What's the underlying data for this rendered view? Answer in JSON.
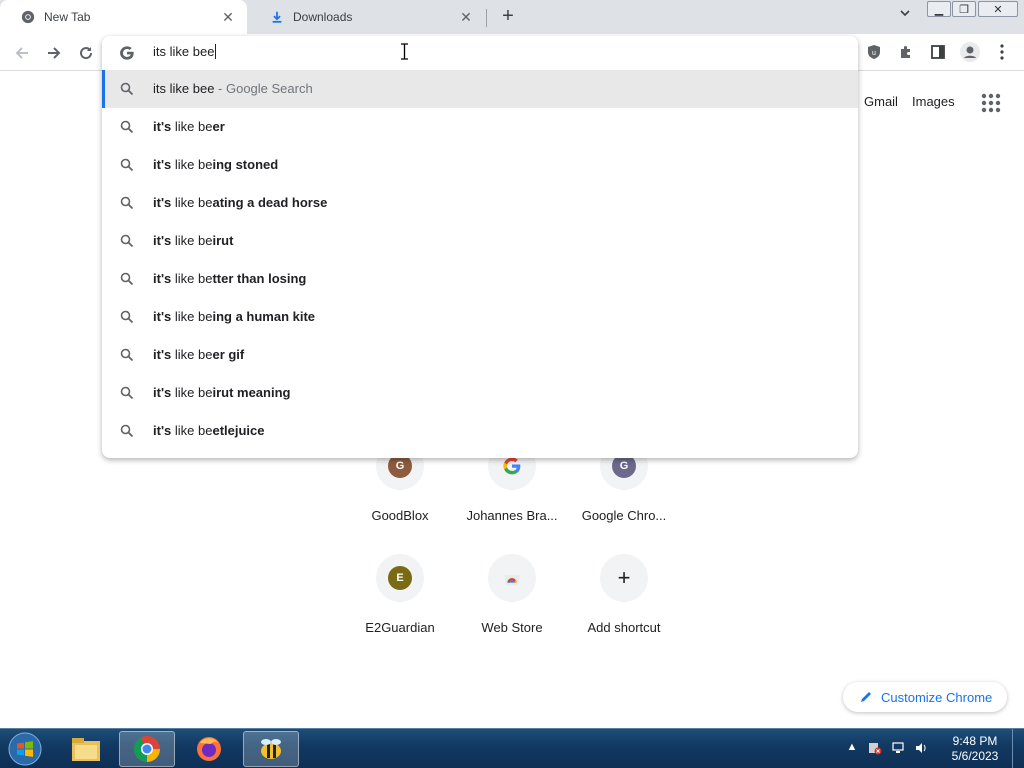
{
  "tabs": [
    {
      "title": "New Tab",
      "icon": "chrome-icon"
    },
    {
      "title": "Downloads",
      "icon": "download-icon"
    }
  ],
  "omnibox": {
    "input_value": "its like bee",
    "selected": {
      "query": "its like bee",
      "suffix": " - Google Search"
    },
    "suggestions": [
      {
        "prefix": "it's",
        "mid": " like be",
        "completion": "er"
      },
      {
        "prefix": "it's",
        "mid": " like be",
        "completion": "ing stoned"
      },
      {
        "prefix": "it's",
        "mid": " like be",
        "completion": "ating a dead horse"
      },
      {
        "prefix": "it's",
        "mid": " like be",
        "completion": "irut"
      },
      {
        "prefix": "it's",
        "mid": " like be",
        "completion": "tter than losing"
      },
      {
        "prefix": "it's",
        "mid": " like be",
        "completion": "ing a human kite"
      },
      {
        "prefix": "it's",
        "mid": " like be",
        "completion": "er gif"
      },
      {
        "prefix": "it's",
        "mid": " like be",
        "completion": "irut meaning"
      },
      {
        "prefix": "it's",
        "mid": " like be",
        "completion": "etlejuice"
      }
    ]
  },
  "header_links": {
    "gmail": "Gmail",
    "images": "Images"
  },
  "shortcuts": [
    {
      "label": "GoodBlox",
      "letter": "G",
      "color": "#8d5c3e"
    },
    {
      "label": "Johannes Bra...",
      "letter": "G",
      "color": "google"
    },
    {
      "label": "Google Chro...",
      "letter": "G",
      "color": "#6b6a8a"
    },
    {
      "label": "E2Guardian",
      "letter": "E",
      "color": "#7a6a12"
    },
    {
      "label": "Web Store",
      "letter": "",
      "color": "webstore"
    },
    {
      "label": "Add shortcut",
      "letter": "+",
      "color": "add"
    }
  ],
  "customize_label": "Customize Chrome",
  "taskbar": {
    "apps": [
      "file-explorer-icon",
      "chrome-icon",
      "firefox-icon",
      "bee-app-icon"
    ],
    "time": "9:48 PM",
    "date": "5/6/2023"
  },
  "colors": {
    "accent": "#1a73e8",
    "tabstrip": "#dee1e6"
  }
}
